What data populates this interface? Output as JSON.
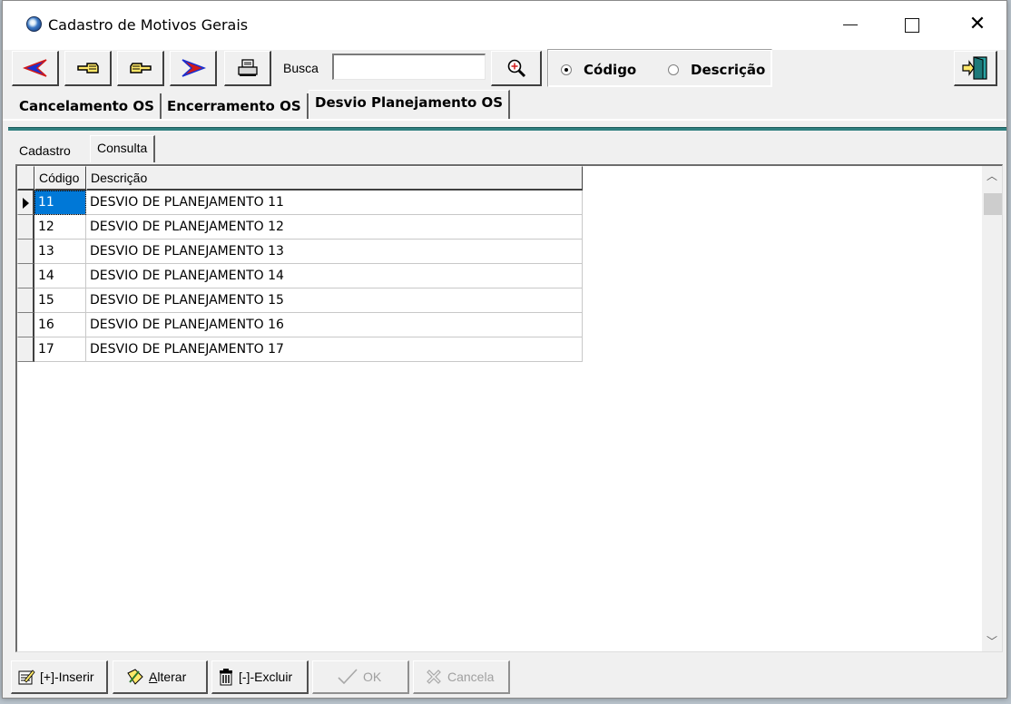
{
  "window": {
    "title": "Cadastro de Motivos Gerais",
    "minimize_glyph": "—",
    "maximize_glyph": "☐",
    "close_glyph": "✕"
  },
  "toolbar": {
    "first_icon": "first-record-arrow-icon",
    "prev_icon": "prev-hand-icon",
    "next_icon": "next-hand-icon",
    "last_icon": "last-record-arrow-icon",
    "print_icon": "printer-icon",
    "busca_label": "Busca",
    "busca_value": "",
    "search_icon": "magnifier-icon",
    "radio_codigo": "Código",
    "radio_descricao": "Descrição",
    "selected_radio": "Código",
    "exit_icon": "exit-door-icon"
  },
  "main_tabs": [
    {
      "label": "Cancelamento OS"
    },
    {
      "label": "Encerramento OS"
    },
    {
      "label": "Desvio Planejamento OS",
      "active": true
    }
  ],
  "sub_tabs": [
    {
      "label": "Cadastro"
    },
    {
      "label": "Consulta",
      "active": true
    }
  ],
  "grid": {
    "columns": [
      "Código",
      "Descrição"
    ],
    "rows": [
      {
        "codigo": "11",
        "descricao": "DESVIO DE PLANEJAMENTO 11",
        "current": true
      },
      {
        "codigo": "12",
        "descricao": "DESVIO DE PLANEJAMENTO 12"
      },
      {
        "codigo": "13",
        "descricao": "DESVIO DE PLANEJAMENTO 13"
      },
      {
        "codigo": "14",
        "descricao": "DESVIO DE PLANEJAMENTO 14"
      },
      {
        "codigo": "15",
        "descricao": "DESVIO DE PLANEJAMENTO 15"
      },
      {
        "codigo": "16",
        "descricao": "DESVIO DE PLANEJAMENTO 16"
      },
      {
        "codigo": "17",
        "descricao": "DESVIO DE PLANEJAMENTO 17"
      }
    ]
  },
  "bottom": {
    "inserir_prefix": "[+]-",
    "inserir_label": "Inserir",
    "alterar_u": "A",
    "alterar_rest": "lterar",
    "excluir_label": "[-]-Excluir",
    "ok_label": "OK",
    "cancela_label": "Cancela"
  },
  "colors": {
    "selection": "#0078d7",
    "teal_divider": "#2f7f7f",
    "nav_arrow_blue": "#1a2fd0",
    "nav_arrow_red": "#d01a1a"
  }
}
